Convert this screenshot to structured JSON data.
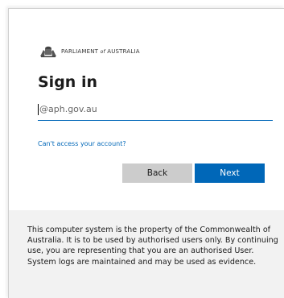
{
  "brand": {
    "org_name_part1": "PARLIAMENT",
    "org_name_of": "of",
    "org_name_part2": "AUSTRALIA"
  },
  "signin": {
    "title": "Sign in",
    "username_value": "@aph.gov.au",
    "cant_access_link": "Can't access your account?",
    "back_label": "Back",
    "next_label": "Next"
  },
  "disclaimer": {
    "text": "This computer system is the property of the Commonwealth of Australia. It is to be used by authorised users only. By continuing use, you are representing that you are an authorised User. System logs are maintained and may be used as evidence."
  },
  "colors": {
    "accent": "#0067b8",
    "button_secondary": "#cccccc",
    "footer_bg": "#f2f2f2"
  }
}
